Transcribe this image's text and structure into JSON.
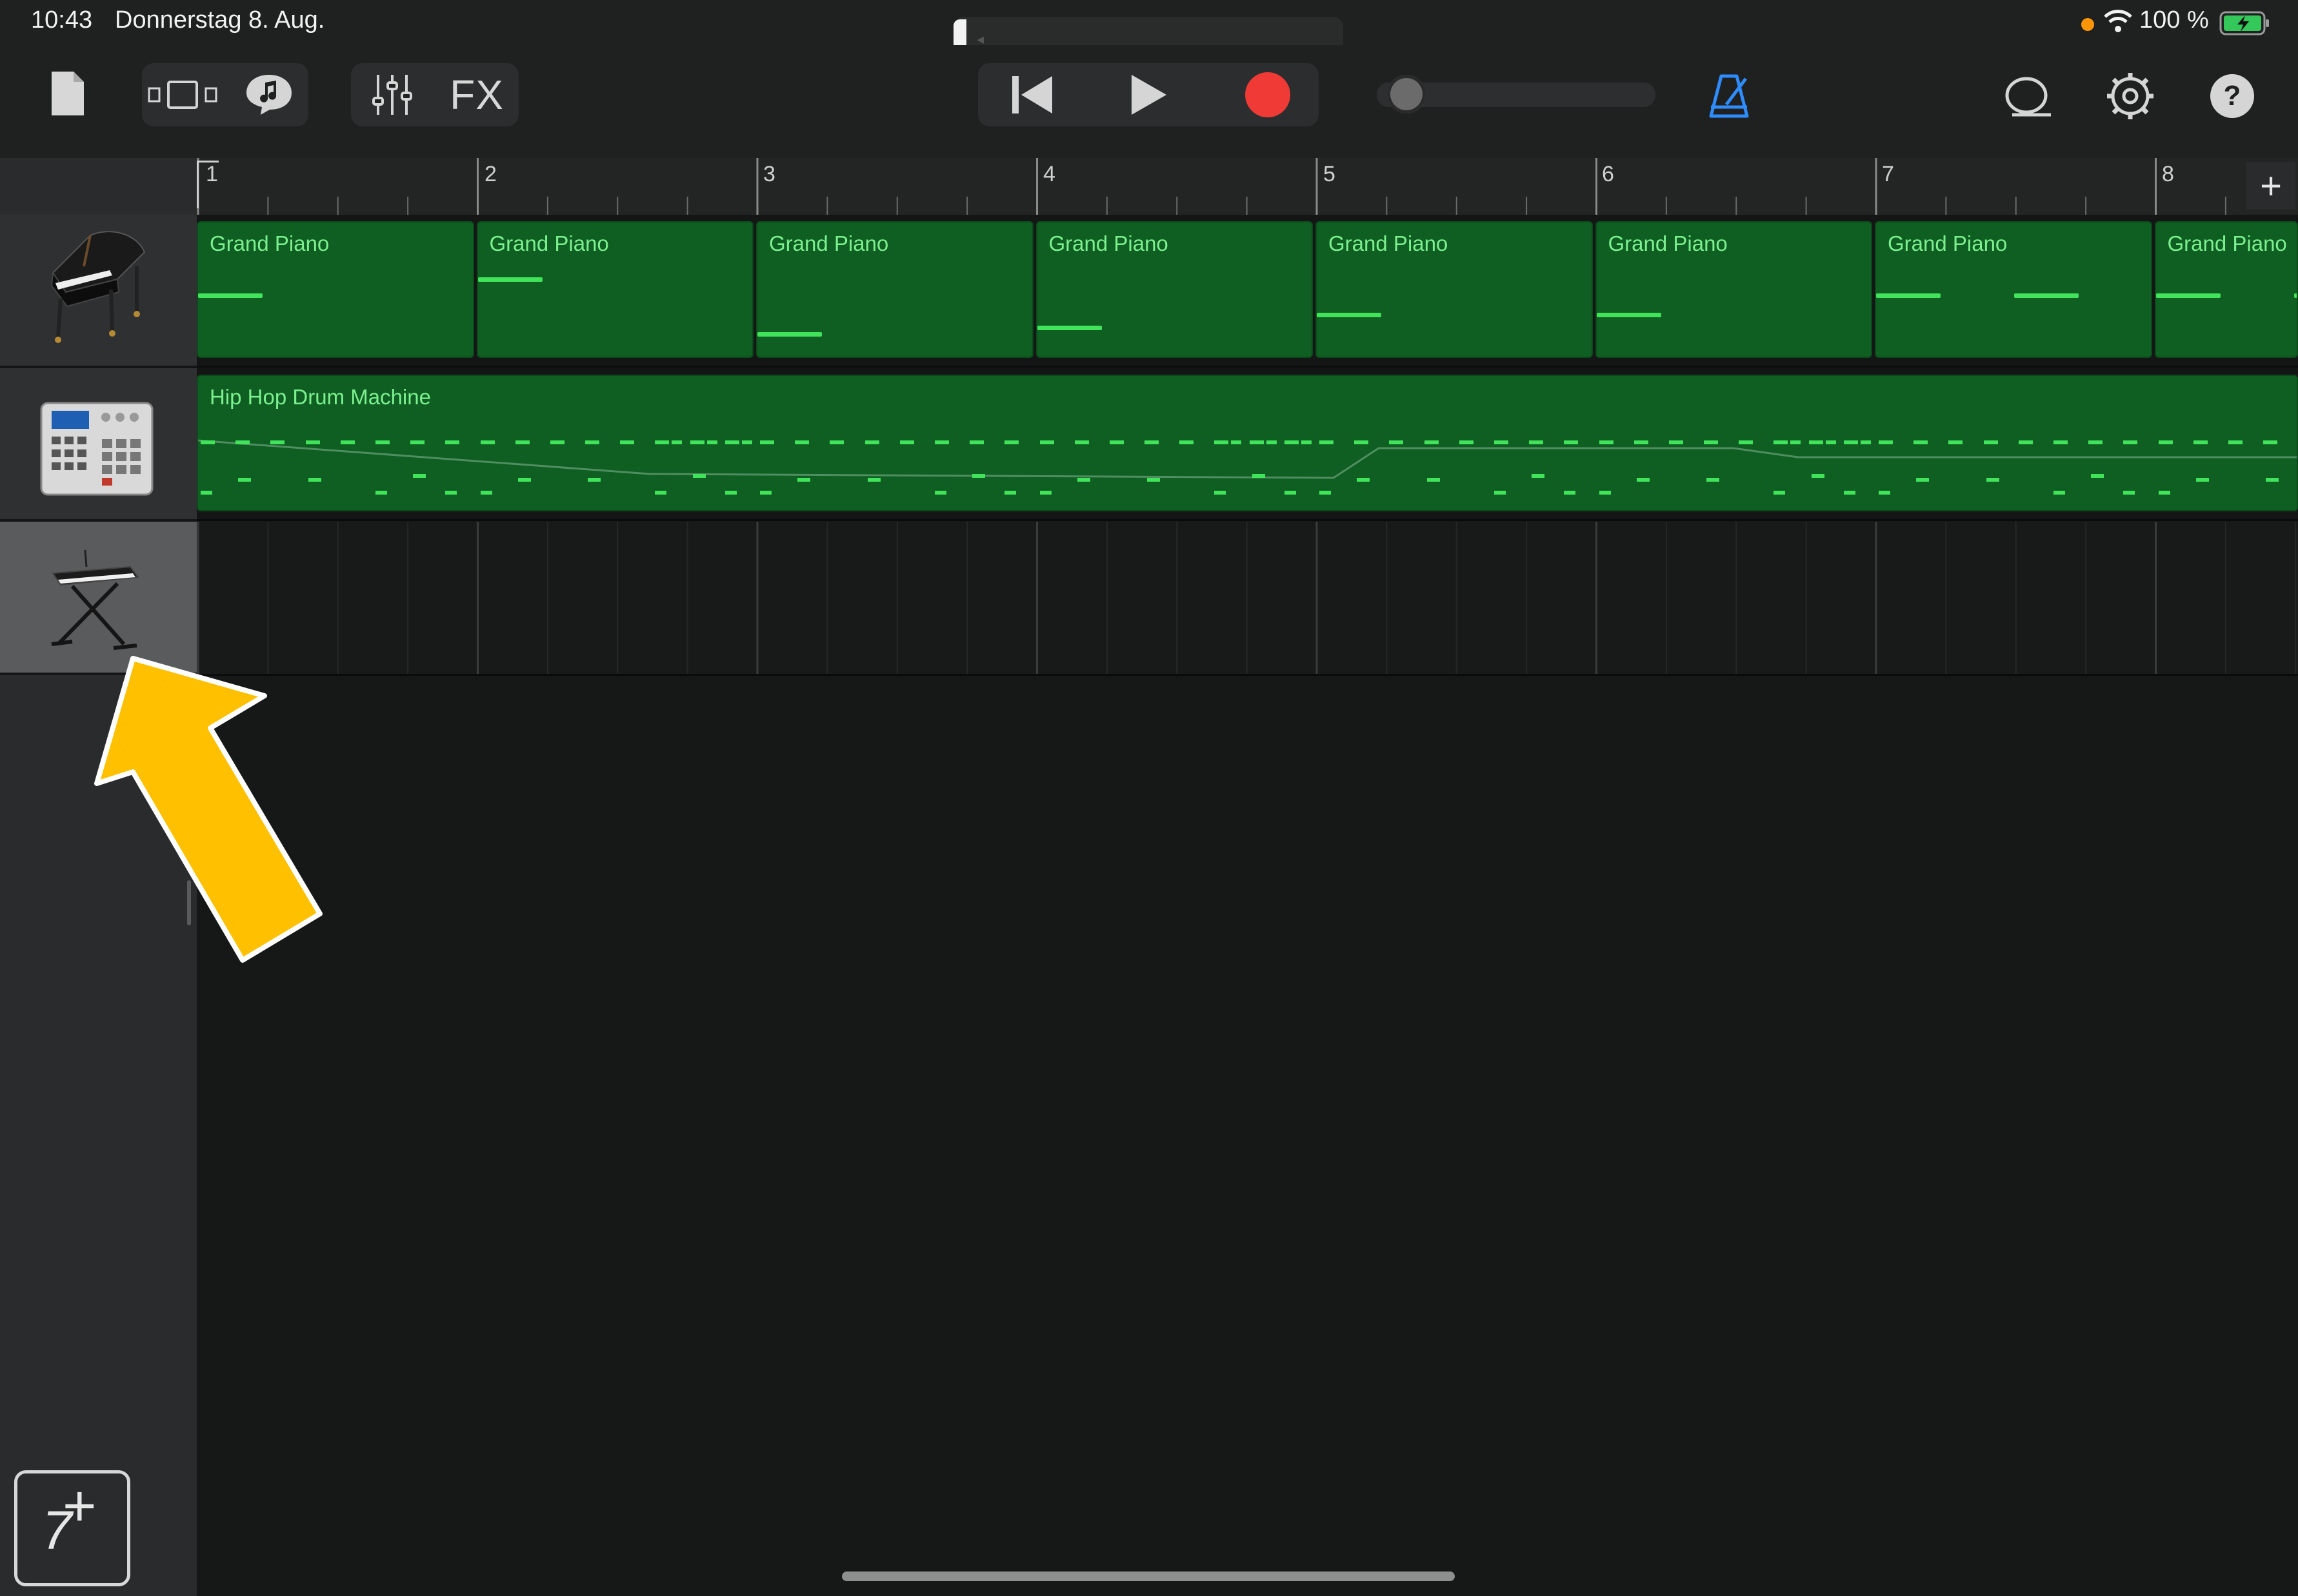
{
  "status_bar": {
    "time": "10:43",
    "date": "Donnerstag 8. Aug.",
    "battery": "100 %",
    "icons": [
      "orange-dot-indicator",
      "wifi-icon",
      "battery-charging-icon"
    ]
  },
  "toolbar": {
    "left": [
      "my-songs-icon",
      "browser-icon",
      "loops-icon",
      "mixer-icon"
    ],
    "fx_label": "FX",
    "transport": [
      "go-to-beginning-icon",
      "play-icon",
      "record-icon"
    ],
    "right": [
      "metronome-icon",
      "loop-browser-icon",
      "settings-icon",
      "help-icon"
    ],
    "help_label": "?"
  },
  "ruler": {
    "bars": [
      "1",
      "2",
      "3",
      "4",
      "5",
      "6",
      "7",
      "8"
    ],
    "add_section_label": "+"
  },
  "tracks": [
    {
      "instrument": "Grand Piano",
      "icon": "grand-piano-icon",
      "selected": false,
      "regions": [
        "Grand Piano",
        "Grand Piano",
        "Grand Piano",
        "Grand Piano",
        "Grand Piano",
        "Grand Piano",
        "Grand Piano",
        "Grand Piano"
      ]
    },
    {
      "instrument": "Hip Hop Drum Machine",
      "icon": "drum-machine-icon",
      "selected": false,
      "regions": [
        "Hip Hop Drum Machine"
      ]
    },
    {
      "instrument": "Keyboard",
      "icon": "keyboard-stand-icon",
      "selected": true,
      "regions": []
    }
  ],
  "add_track_button": {
    "label": "+"
  },
  "annotation": {
    "icon": "yellow-arrow-icon",
    "color": "#ffc000"
  },
  "colors": {
    "region_fill": "#0f5e22",
    "note": "#41e35b",
    "record": "#f03a35",
    "metronome": "#2f8cff"
  }
}
